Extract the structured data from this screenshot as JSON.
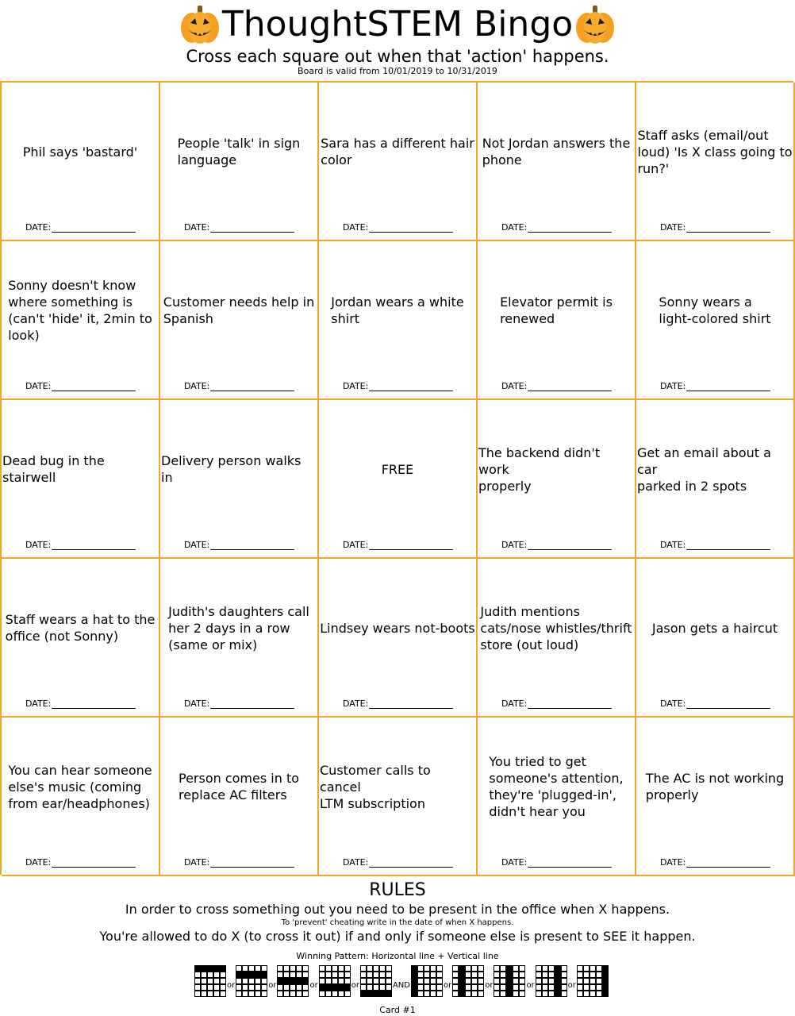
{
  "header": {
    "title": "ThoughtSTEM Bingo",
    "subtitle": "Cross each square out when that 'action' happens.",
    "validity": "Board is valid from 10/01/2019 to 10/31/2019",
    "left_icon": "pumpkin-icon",
    "right_icon": "pumpkin-icon"
  },
  "colors": {
    "grid_border": "#f3a729",
    "pumpkin_body": "#f6a021",
    "pumpkin_face": "#1a1a1a"
  },
  "date_label": "DATE:",
  "cells": [
    "Phil says 'bastard'",
    "People 'talk' in sign\n language",
    "Sara has a different hair\n color",
    "Not Jordan answers the\n phone",
    "Staff asks (email/out\nloud) 'Is X class going to\n run?'",
    "Sonny doesn't know\nwhere something is\n(can't 'hide' it, 2min to\n look)",
    "Customer needs help in\n Spanish",
    "Jordan wears a white\n shirt",
    "Elevator permit is\n renewed",
    "Sonny wears a\n light-colored shirt",
    "Dead bug in the stairwell",
    "Delivery person walks in",
    "FREE",
    "The backend didn't work\n properly",
    "Get an email about a car\n parked in 2 spots",
    "Staff wears a hat to the\n office (not Sonny)",
    "Judith's daughters call\nher 2 days in a row\n (same or mix)",
    "Lindsey wears not-boots",
    "Judith mentions\ncats/nose whistles/thrift\n store (out loud)",
    "Jason gets a haircut",
    "You can hear someone\nelse's music (coming\n from ear/headphones)",
    "Person comes in to\n replace AC filters",
    "Customer calls to cancel\n LTM subscription",
    "You tried to get\nsomeone's attention,\nthey're 'plugged-in',\n didn't hear you",
    "The AC is not working\n properly"
  ],
  "rules": {
    "title": "RULES",
    "line1": "In order to cross something out you need to be present in the office when X happens.",
    "line2": "To 'prevent' cheating write in the date of when X happens.",
    "line3": "You're allowed to do X (to cross it out) if and only if someone else is present to SEE it happen.",
    "winning_pattern": "Winning Pattern: Horizontal line + Vertical line",
    "separators": [
      "or",
      "or",
      "or",
      "or",
      "AND",
      "or",
      "or",
      "or",
      "or"
    ]
  },
  "patterns": [
    {
      "type": "row",
      "index": 0
    },
    {
      "type": "row",
      "index": 1
    },
    {
      "type": "row",
      "index": 2
    },
    {
      "type": "row",
      "index": 3
    },
    {
      "type": "row",
      "index": 4
    },
    {
      "type": "col",
      "index": 0
    },
    {
      "type": "col",
      "index": 1
    },
    {
      "type": "col",
      "index": 2
    },
    {
      "type": "col",
      "index": 3
    },
    {
      "type": "col",
      "index": 4
    }
  ],
  "card_number": "Card #1"
}
